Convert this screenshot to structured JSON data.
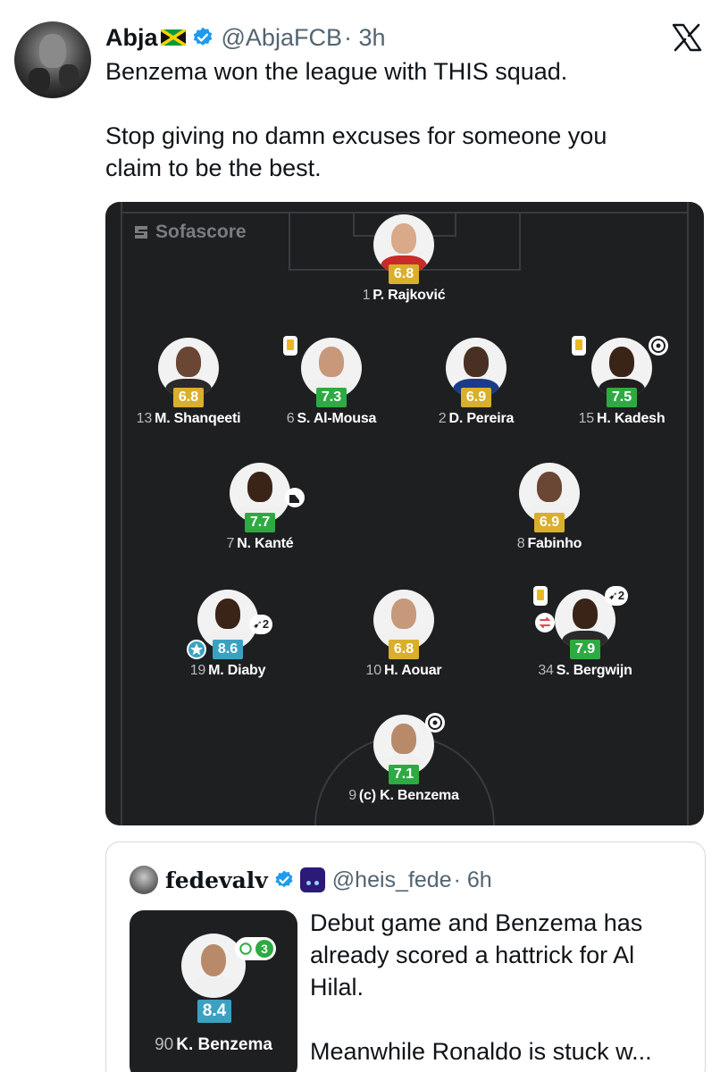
{
  "tweet": {
    "author_name": "Abja",
    "author_flag_icon": "jamaica-flag-icon",
    "handle": "@AbjaFCB",
    "time": "· 3h",
    "text_lines": [
      "Benzema won the league with THIS squad.",
      "",
      "Stop giving no damn excuses for someone you",
      "claim to be the best."
    ]
  },
  "lineup": {
    "brand": "Sofascore",
    "players": [
      {
        "number": "1",
        "name": "P. Rajković",
        "rating": "6.8",
        "rating_color": "#d9af2b"
      },
      {
        "number": "13",
        "name": "M. Shanqeeti",
        "rating": "6.8",
        "rating_color": "#d9af2b"
      },
      {
        "number": "6",
        "name": "S. Al-Mousa",
        "rating": "7.3",
        "rating_color": "#2eaa42"
      },
      {
        "number": "2",
        "name": "D. Pereira",
        "rating": "6.9",
        "rating_color": "#d9af2b"
      },
      {
        "number": "15",
        "name": "H. Kadesh",
        "rating": "7.5",
        "rating_color": "#2eaa42"
      },
      {
        "number": "7",
        "name": "N. Kanté",
        "rating": "7.7",
        "rating_color": "#2eaa42"
      },
      {
        "number": "8",
        "name": "Fabinho",
        "rating": "6.9",
        "rating_color": "#d9af2b"
      },
      {
        "number": "19",
        "name": "M. Diaby",
        "rating": "8.6",
        "rating_color": "#3aa2c0"
      },
      {
        "number": "10",
        "name": "H. Aouar",
        "rating": "6.8",
        "rating_color": "#d9af2b"
      },
      {
        "number": "34",
        "name": "S. Bergwijn",
        "rating": "7.9",
        "rating_color": "#2eaa42"
      },
      {
        "number": "9",
        "name": "(c) K. Benzema",
        "rating": "7.1",
        "rating_color": "#2eaa42"
      }
    ],
    "assist_count_diaby": "2",
    "assist_count_bergwijn": "2"
  },
  "quote": {
    "author_name": "fedevalv",
    "handle": "@heis_fede",
    "time": "· 6h",
    "player_number": "90",
    "player_name": "K. Benzema",
    "player_rating": "8.4",
    "goals": "3",
    "text_lines": [
      "Debut game and Benzema has",
      "already scored a hattrick for Al",
      "Hilal.",
      "",
      "Meanwhile Ronaldo is stuck w..."
    ]
  }
}
